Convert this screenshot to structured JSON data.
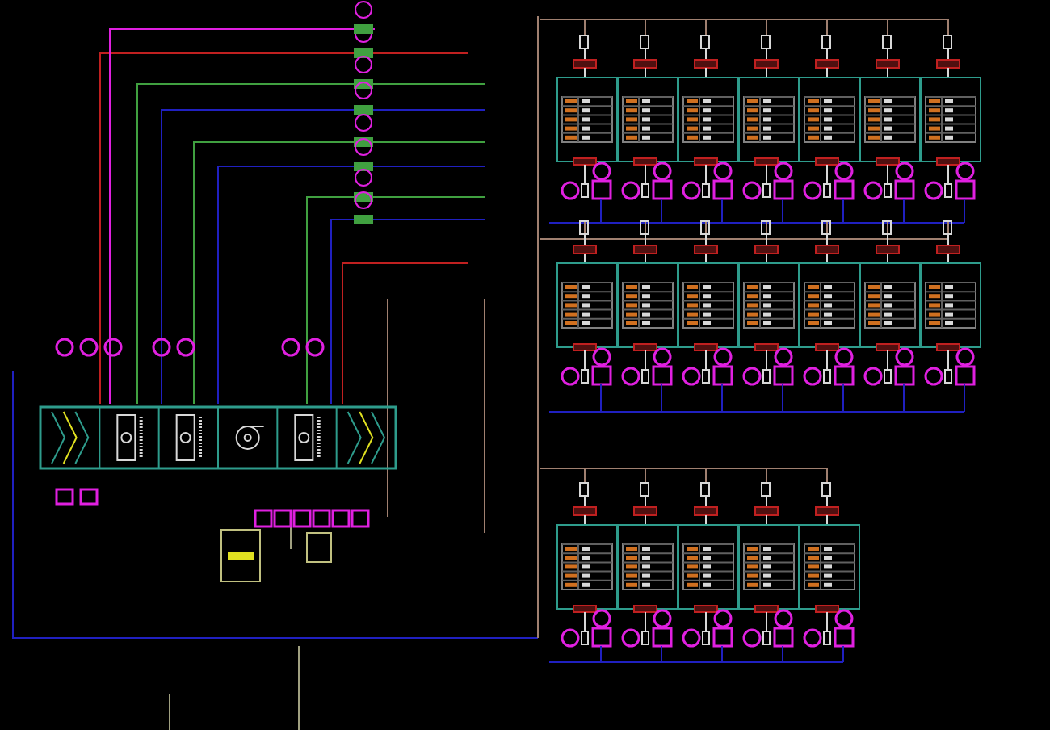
{
  "schematic": {
    "air_handler": {
      "sections": [
        {
          "kind": "filter"
        },
        {
          "kind": "coil"
        },
        {
          "kind": "coil"
        },
        {
          "kind": "fan"
        },
        {
          "kind": "coil"
        },
        {
          "kind": "filter"
        }
      ]
    },
    "zone_groups": [
      {
        "units": [
          {
            "kind": "terminal"
          },
          {
            "kind": "terminal"
          },
          {
            "kind": "terminal"
          },
          {
            "kind": "terminal"
          },
          {
            "kind": "terminal"
          },
          {
            "kind": "terminal"
          },
          {
            "kind": "terminal"
          }
        ]
      },
      {
        "units": [
          {
            "kind": "terminal"
          },
          {
            "kind": "terminal"
          },
          {
            "kind": "terminal"
          },
          {
            "kind": "terminal"
          },
          {
            "kind": "terminal"
          },
          {
            "kind": "terminal"
          },
          {
            "kind": "terminal"
          }
        ]
      },
      {
        "units": [
          {
            "kind": "terminal"
          },
          {
            "kind": "terminal"
          },
          {
            "kind": "terminal"
          },
          {
            "kind": "terminal"
          },
          {
            "kind": "terminal"
          }
        ]
      }
    ]
  }
}
